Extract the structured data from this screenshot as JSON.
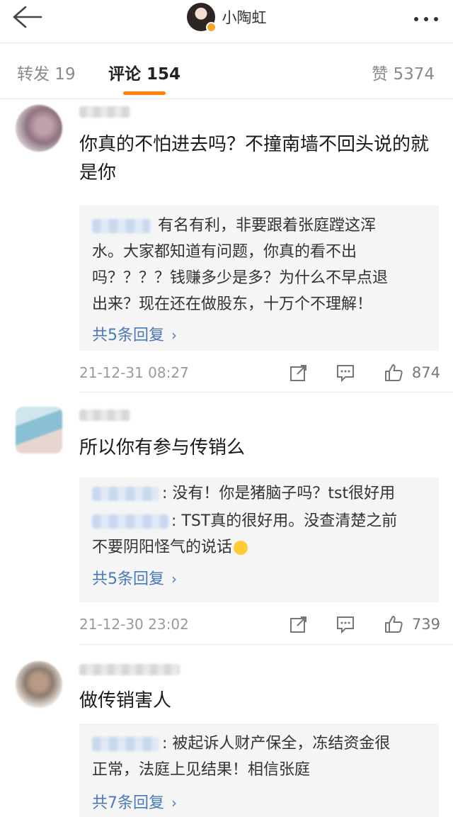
{
  "header": {
    "title": "小陶虹"
  },
  "tabs": {
    "forward": "转发 19",
    "comment": "评论 154",
    "like": "赞 5374"
  },
  "comments": [
    {
      "text": "你真的不怕进去吗？不撞南墙不回头说的就是你",
      "replies": [
        "有名有利，非要跟着张庭蹚这浑",
        "水。大家都知道有问题，你真的看不出",
        "吗？？？？钱赚多少是多？为什么不早点退",
        "出来？现在还在做股东，十万个不理解！"
      ],
      "more_replies": "共5条回复",
      "time": "21-12-31 08:27",
      "likes": "874"
    },
    {
      "text": "所以你有参与传销么",
      "replies": [
        ": 没有！你是猪脑子吗？tst很好用",
        ": TST真的很好用。没查清楚之前",
        "不要阴阳怪气的说话"
      ],
      "more_replies": "共5条回复",
      "time": "21-12-30 23:02",
      "likes": "739"
    },
    {
      "text": "做传销害人",
      "replies": [
        ": 被起诉人财产保全，冻结资金很",
        "正常，法庭上见结果！相信张庭"
      ],
      "more_replies": "共7条回复"
    }
  ],
  "icons": {
    "back": "arrow-left-icon",
    "more": "more-dots-icon",
    "verified": "verified-badge-icon",
    "repost": "repost-icon",
    "reply": "comment-icon",
    "like": "thumbs-up-icon",
    "emoji": "smirk-emoji-icon"
  },
  "colors": {
    "accent": "#ff8200",
    "link": "#4a78b8",
    "badge": "#f5a623"
  }
}
